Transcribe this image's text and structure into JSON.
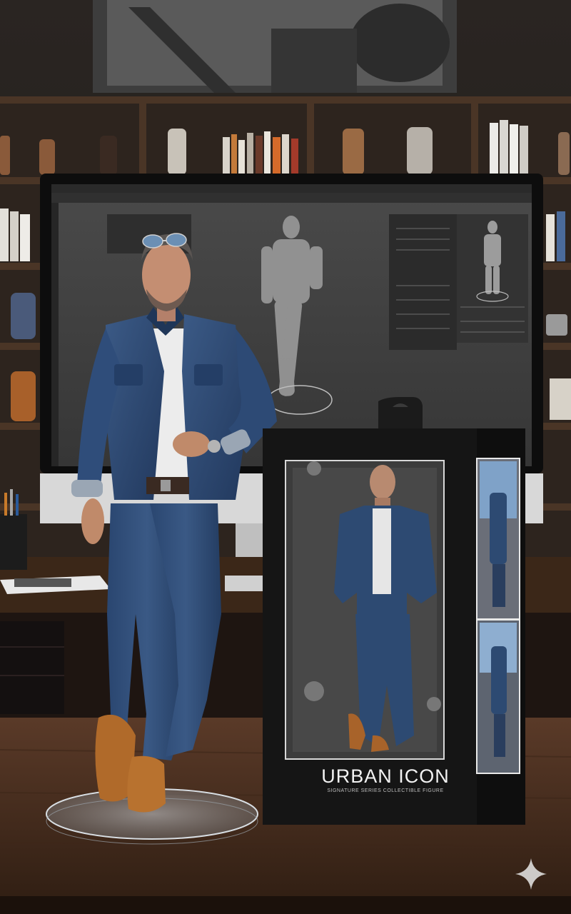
{
  "product": {
    "name": "URBAN ICON",
    "tagline": "SIGNATURE SERIES COLLECTIBLE FIGURE"
  },
  "scene": {
    "description_icons": [
      "sparkle-icon"
    ],
    "colors": {
      "denim": "#2d4a72",
      "box": "#141414",
      "desk": "#4a2e1e",
      "boots": "#b06a2a"
    }
  }
}
